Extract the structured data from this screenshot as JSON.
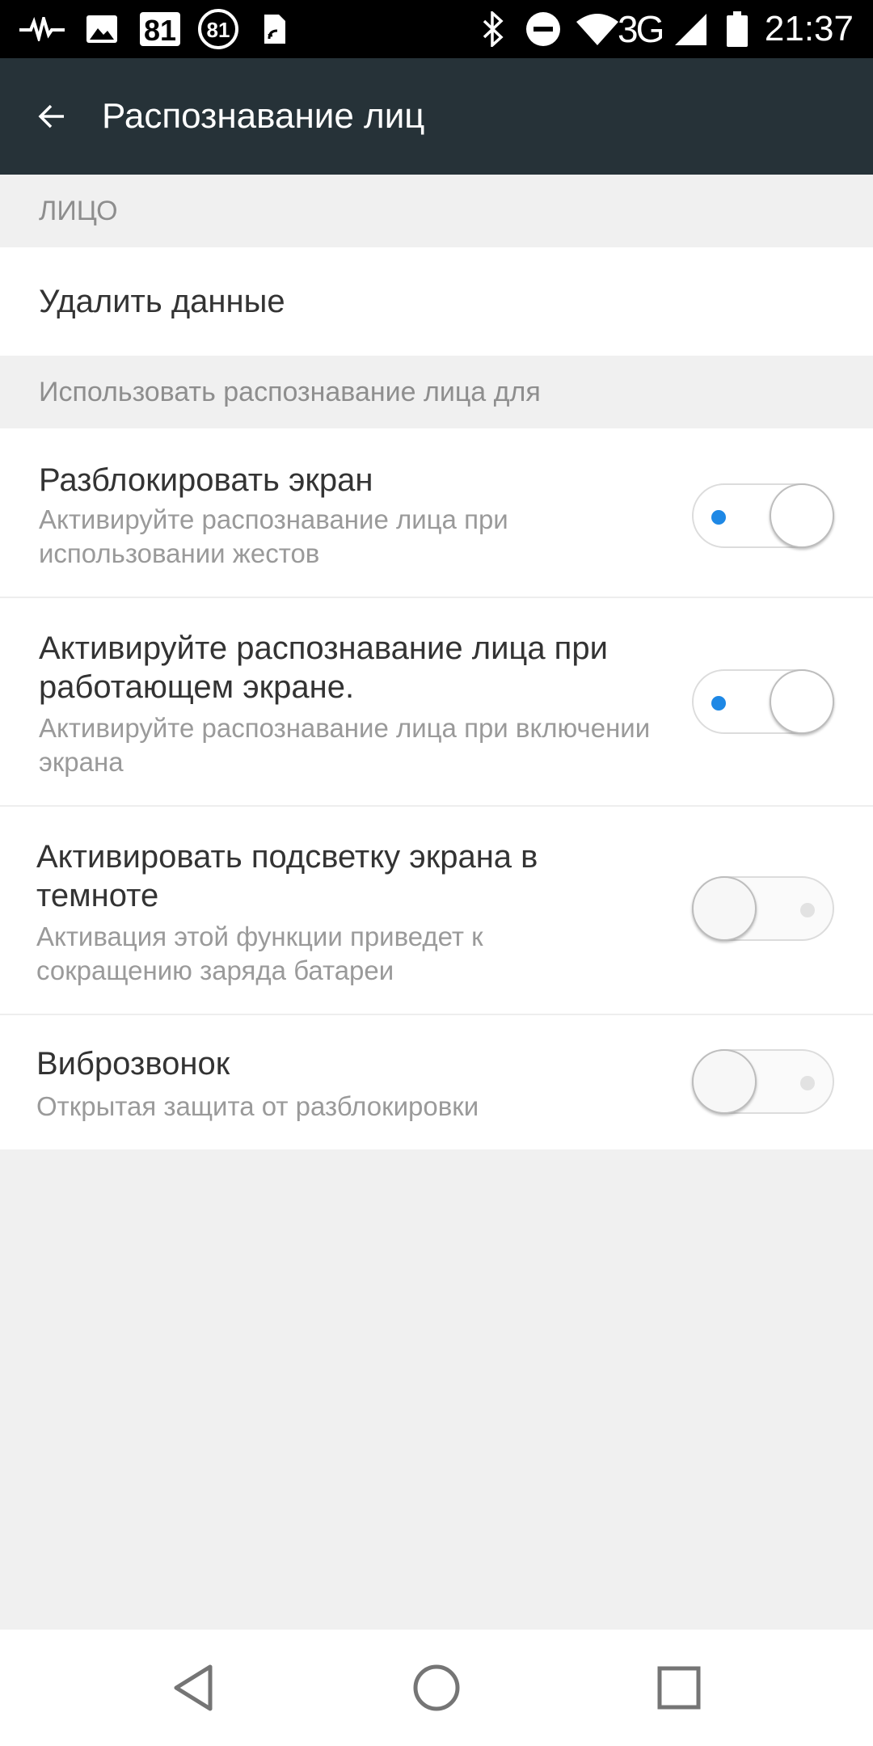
{
  "status_bar": {
    "time": "21:37",
    "network": "3G",
    "icons": [
      "pulse-icon",
      "image-icon",
      "badge-81-icon",
      "circle-81-icon",
      "sim-icon",
      "bluetooth-icon",
      "dnd-icon",
      "wifi-icon",
      "signal-icon",
      "battery-icon"
    ],
    "badge_number": "81",
    "circle_number": "81"
  },
  "app_bar": {
    "title": "Распознавание лиц",
    "background": "#263238"
  },
  "sections": [
    {
      "header": "ЛИЦО"
    },
    {
      "header": "Использовать распознавание лица для"
    }
  ],
  "delete_row": {
    "label": "Удалить данные"
  },
  "settings": [
    {
      "title": "Разблокировать экран",
      "subtitle": "Активируйте распознавание лица при использовании жестов",
      "enabled": true
    },
    {
      "title": "Активируйте распознавание лица при работающем экране.",
      "subtitle": "Активируйте распознавание лица при включении экрана",
      "enabled": true
    },
    {
      "title": "Активировать подсветку экрана в темноте",
      "subtitle": "Активация этой функции приведет к сокращению заряда батареи",
      "enabled": false
    },
    {
      "title": "Виброзвонок",
      "subtitle": "Открытая защита от разблокировки",
      "enabled": false
    }
  ],
  "accent_color": "#1e88e5",
  "nav_bar": {
    "icons": [
      "back-triangle-icon",
      "home-circle-icon",
      "recents-square-icon"
    ]
  }
}
